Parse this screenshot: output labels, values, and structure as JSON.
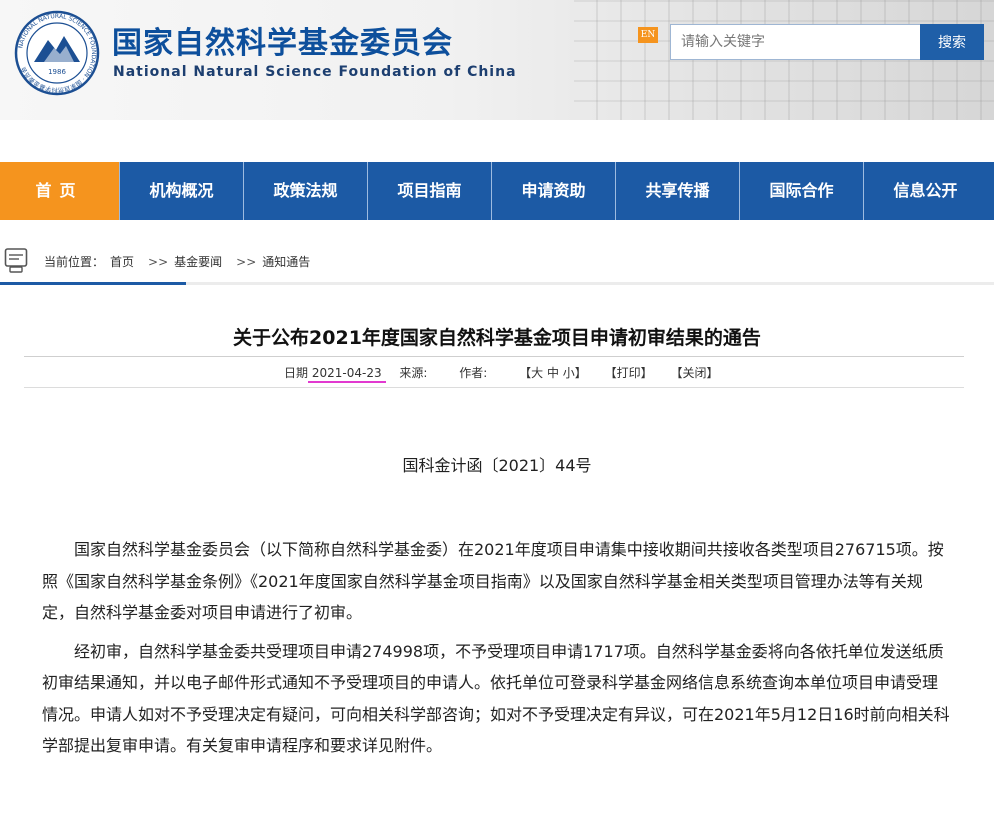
{
  "header": {
    "logo_year": "1986",
    "title_cn": "国家自然科学基金委员会",
    "title_en": "National Natural Science Foundation of China",
    "lang_badge": "EN",
    "search": {
      "placeholder": "请输入关键字",
      "button": "搜索"
    }
  },
  "nav": {
    "items": [
      "首页",
      "机构概况",
      "政策法规",
      "项目指南",
      "申请资助",
      "共享传播",
      "国际合作",
      "信息公开"
    ],
    "active_color": "#f5941e",
    "bg_color": "#1c5aa5"
  },
  "breadcrumb": {
    "prefix": "当前位置：",
    "items": [
      "首页",
      "基金要闻",
      "通知通告"
    ],
    "separator": ">>"
  },
  "article": {
    "title": "关于公布2021年度国家自然科学基金项目申请初审结果的通告",
    "meta": {
      "date_label": "日期",
      "date": "2021-04-23",
      "source_label": "来源:",
      "author_label": "作者:",
      "font_size": "【大 中 小】",
      "print": "【打印】",
      "close": "【关闭】"
    },
    "doc_number": "国科金计函〔2021〕44号",
    "paragraphs": [
      "国家自然科学基金委员会（以下简称自然科学基金委）在2021年度项目申请集中接收期间共接收各类型项目276715项。按照《国家自然科学基金条例》《2021年度国家自然科学基金项目指南》以及国家自然科学基金相关类型项目管理办法等有关规定，自然科学基金委对项目申请进行了初审。",
      "经初审，自然科学基金委共受理项目申请274998项，不予受理项目申请1717项。自然科学基金委将向各依托单位发送纸质初审结果通知，并以电子邮件形式通知不予受理项目的申请人。依托单位可登录科学基金网络信息系统查询本单位项目申请受理情况。申请人如对不予受理决定有疑问，可向相关科学部咨询；如对不予受理决定有异议，可在2021年5月12日16时前向相关科学部提出复审申请。有关复审申请程序和要求详见附件。"
    ]
  }
}
